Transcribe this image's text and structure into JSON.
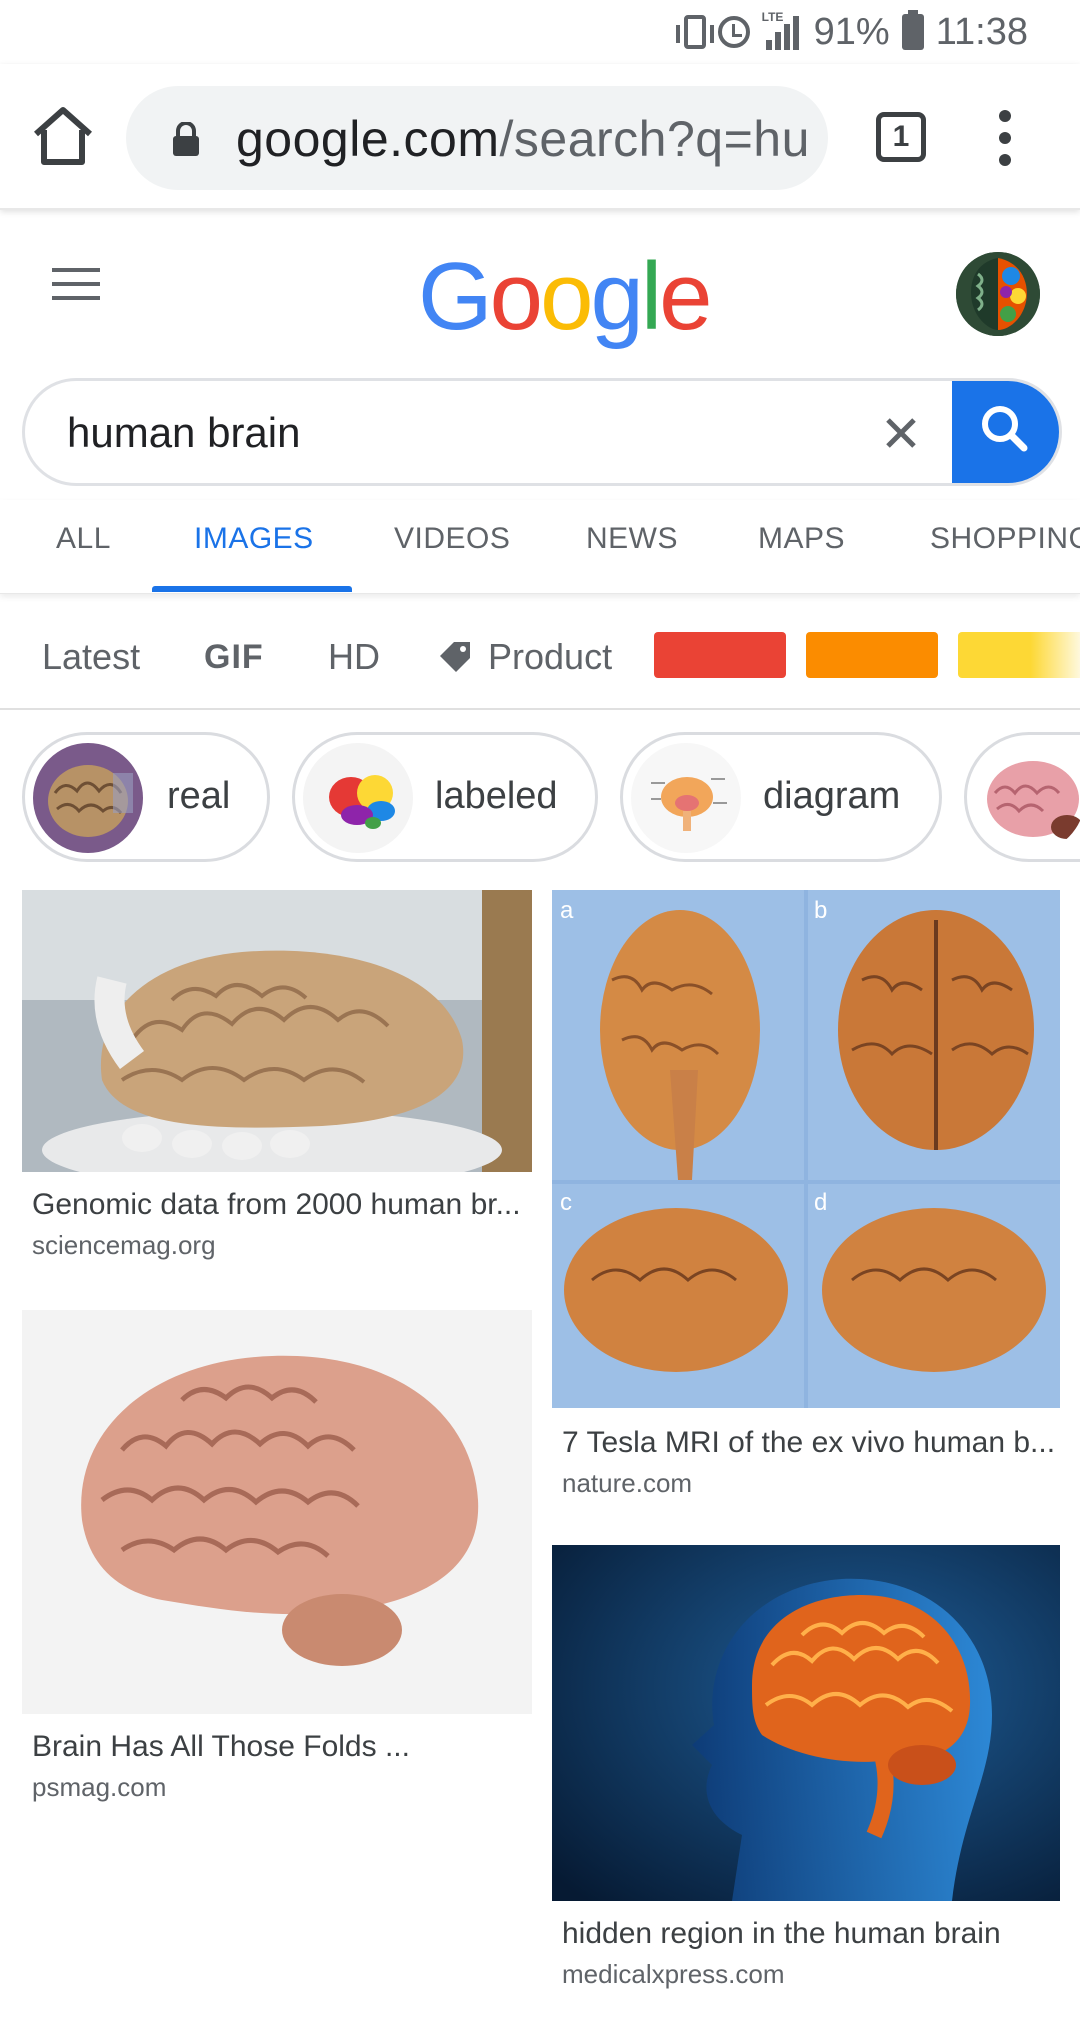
{
  "status_bar": {
    "battery": "91%",
    "time": "11:38",
    "network": "LTE"
  },
  "browser": {
    "url_domain": "google.com",
    "url_path": "/search?q=human+brain",
    "tab_count": "1"
  },
  "google": {
    "logo_letters": [
      "G",
      "o",
      "o",
      "g",
      "l",
      "e"
    ],
    "logo_colors": [
      "#4285F4",
      "#EA4335",
      "#FBBC05",
      "#4285F4",
      "#34A853",
      "#EA4335"
    ],
    "search_query": "human brain"
  },
  "tabs": [
    "ALL",
    "IMAGES",
    "VIDEOS",
    "NEWS",
    "MAPS",
    "SHOPPING"
  ],
  "active_tab": "IMAGES",
  "filters": {
    "latest": "Latest",
    "gif": "GIF",
    "hd": "HD",
    "product": "Product",
    "color_swatches": [
      "#ea4335",
      "#fb8c00",
      "#fdd835"
    ]
  },
  "chips": [
    {
      "label": "real",
      "thumb": "brain-real-thumb"
    },
    {
      "label": "labeled",
      "thumb": "brain-labeled-thumb"
    },
    {
      "label": "diagram",
      "thumb": "brain-diagram-thumb"
    },
    {
      "label": "",
      "thumb": "brain-pink-thumb"
    }
  ],
  "results": [
    {
      "title": "Genomic data from 2000 human br...",
      "source": "sciencemag.org"
    },
    {
      "title": "7 Tesla MRI of the ex vivo human b...",
      "source": "nature.com"
    },
    {
      "title": "Brain Has All Those Folds ...",
      "source": "psmag.com"
    },
    {
      "title": "hidden region in the human brain",
      "source": "medicalxpress.com"
    }
  ],
  "mri_panel_labels": [
    "a",
    "b",
    "c",
    "d"
  ],
  "colors": {
    "accent": "#1a73e8",
    "text_secondary": "#5f6368"
  }
}
